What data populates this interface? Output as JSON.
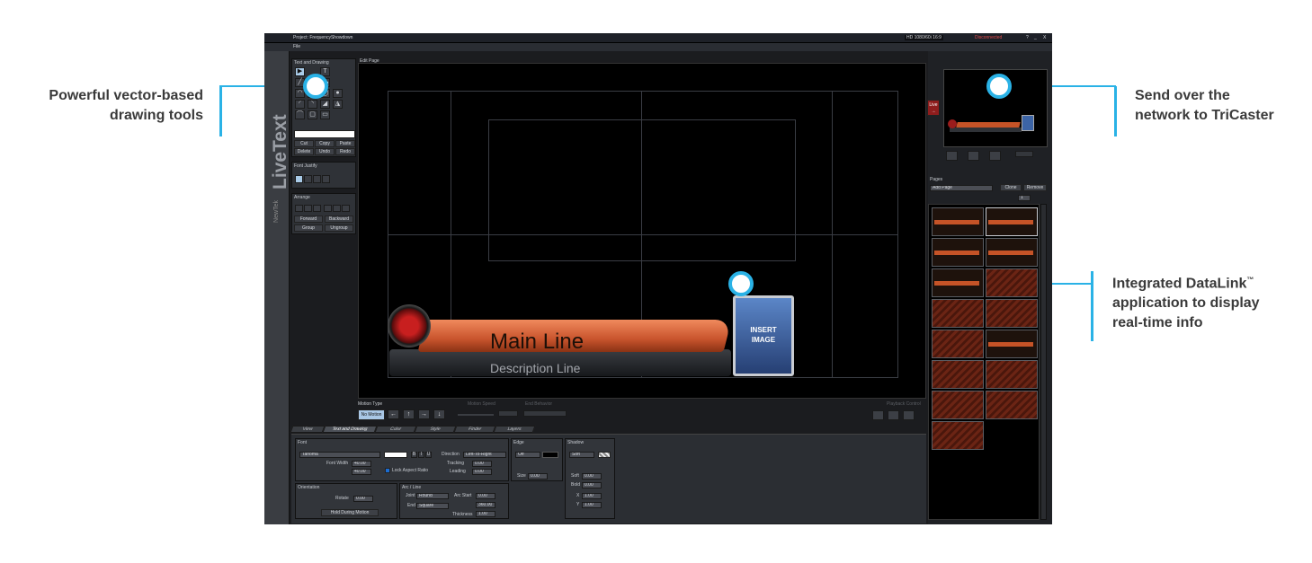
{
  "callouts": {
    "left_top": {
      "line1": "Powerful vector-based",
      "line2": "drawing tools"
    },
    "right_top": {
      "line1": "Send over the",
      "line2": "network to TriCaster"
    },
    "right_mid": {
      "line1": "Integrated DataLink",
      "tm": "™",
      "line2": "application to display",
      "line3": "real-time info"
    }
  },
  "accent_color": "#2ab2e6",
  "app": {
    "title": "Project: FrequencyShowdown",
    "format": "HD 1080/60i 16:9",
    "connection": "Disconnected",
    "window_controls": [
      "?",
      "_",
      "X"
    ],
    "menu": [
      "File"
    ],
    "brand": {
      "logo": "LiveText",
      "company": "NewTek"
    },
    "text_drawing": {
      "title": "Text and Drawing",
      "tools": [
        "▶",
        "T",
        "╱",
        "▬",
        "◠",
        "◐",
        "◯",
        "●",
        "◜",
        "◝",
        "◢",
        "◮",
        "⌒",
        "▢",
        "▭"
      ],
      "buttons": [
        "Cut",
        "Copy",
        "Paste",
        "Delete",
        "Undo",
        "Redo"
      ]
    },
    "font_justify": {
      "title": "Font Justify"
    },
    "arrange": {
      "title": "Arrange",
      "buttons": [
        "Forward",
        "Backward",
        "Group",
        "Ungroup"
      ]
    },
    "edit_page": {
      "title": "Edit Page",
      "main_line": "Main Line",
      "description_line": "Description Line",
      "insert_image": [
        "INSERT",
        "IMAGE"
      ]
    },
    "motion": {
      "type_label": "Motion Type",
      "no_motion": "No Motion",
      "arrows": [
        "←",
        "↑",
        "→",
        "↓"
      ],
      "speed_label": "Motion Speed",
      "end_label": "End Behavior",
      "playback_label": "Playback Control"
    },
    "tabs": [
      "View",
      "Text and Drawing",
      "Color",
      "Style",
      "Finder",
      "Layers"
    ],
    "font": {
      "title": "Font",
      "family": "Tahoma",
      "font_width": "Font Width",
      "font_width_value": "40.00",
      "font_height_value": "40.00",
      "lock_aspect": "Lock Aspect Ratio",
      "direction_label": "Direction",
      "direction_value": "Left-To-Right",
      "tracking_label": "Tracking",
      "tracking_value": "0.00",
      "leading_label": "Leading",
      "leading_value": "0.00"
    },
    "edge": {
      "title": "Edge",
      "value": "Off",
      "size_label": "Size",
      "size_value": "0.00"
    },
    "shadow": {
      "title": "Shadow",
      "value": "Soft",
      "soft_label": "Soft",
      "soft_value": "0.00",
      "bold_label": "Bold",
      "bold_value": "0.00",
      "x_label": "X",
      "x_value": "1.00",
      "y_label": "Y",
      "y_value": "1.00"
    },
    "orientation": {
      "title": "Orientation",
      "rotate_label": "Rotate",
      "rotate_value": "0.00",
      "hold_button": "Hold During Motion"
    },
    "arc_line": {
      "title": "Arc / Line",
      "joint_label": "Joint",
      "joint_value": "Round",
      "end_label": "End",
      "end_value": "Square",
      "arc_start_label": "Arc Start",
      "arc_start_value": "0.00",
      "arc_end_value": "360.00",
      "thickness_label": "Thickness",
      "thickness_value": "1.00"
    },
    "live": {
      "label": "Live"
    },
    "pages": {
      "title": "Pages",
      "add_page": "Add Page",
      "clone": "Clone",
      "remove": "Remove",
      "current": "1"
    }
  }
}
